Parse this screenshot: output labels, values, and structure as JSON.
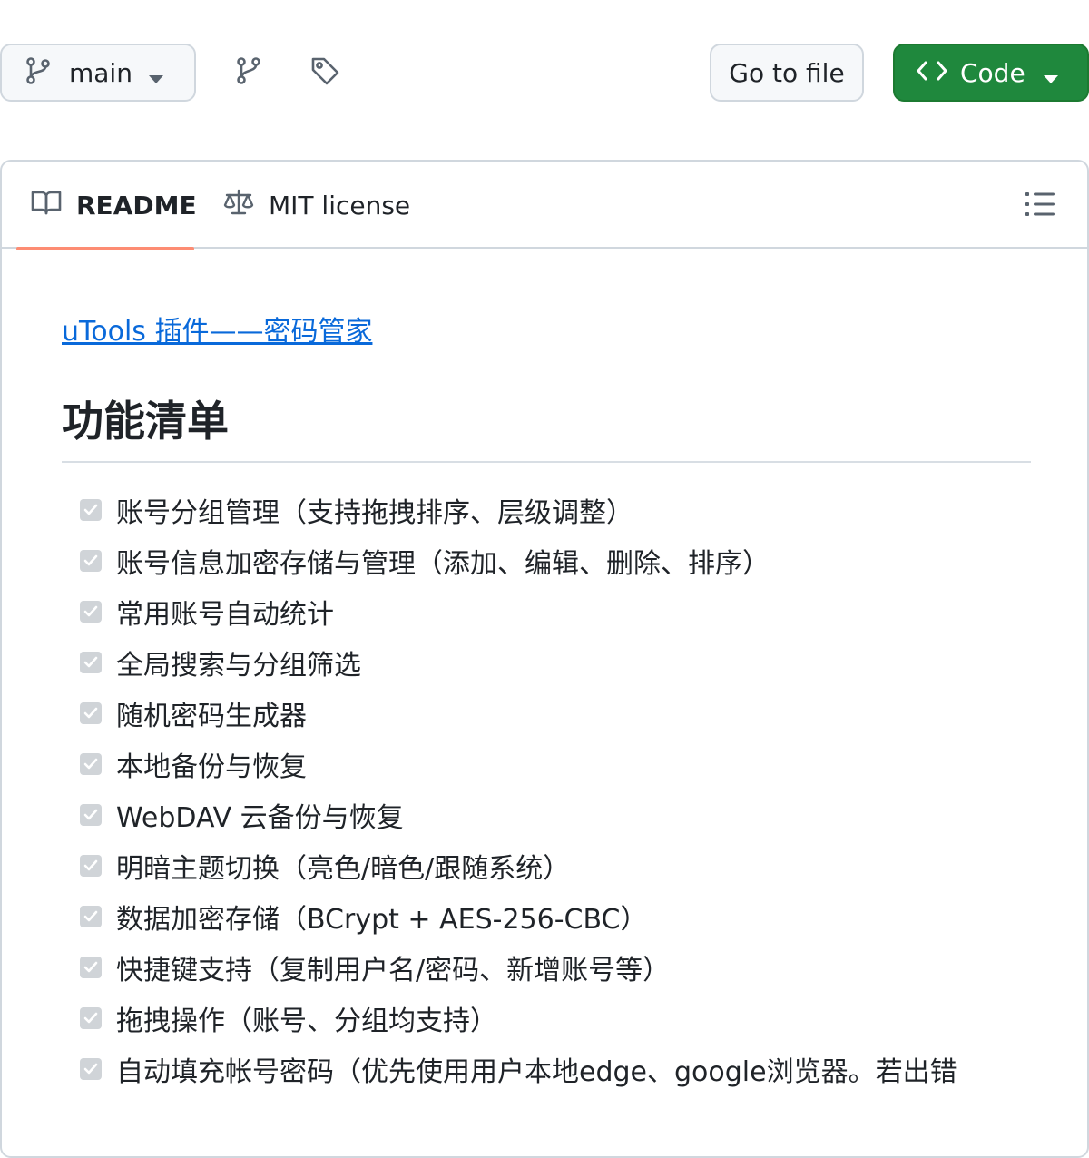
{
  "topbar": {
    "branch_label": "main",
    "goto_file_label": "Go to file",
    "code_label": "Code"
  },
  "readme": {
    "tabs": [
      {
        "label": "README"
      },
      {
        "label": "MIT license"
      }
    ],
    "link_text": "uTools 插件——密码管家",
    "section_title": "功能清单",
    "features": [
      "账号分组管理（支持拖拽排序、层级调整）",
      "账号信息加密存储与管理（添加、编辑、删除、排序）",
      "常用账号自动统计",
      "全局搜索与分组筛选",
      "随机密码生成器",
      "本地备份与恢复",
      "WebDAV 云备份与恢复",
      "明暗主题切换（亮色/暗色/跟随系统）",
      "数据加密存储（BCrypt + AES-256-CBC）",
      "快捷键支持（复制用户名/密码、新增账号等）",
      "拖拽操作（账号、分组均支持）",
      "自动填充帐号密码（优先使用用户本地edge、google浏览器。若出错"
    ]
  },
  "colors": {
    "accent_link": "#0969da",
    "code_button": "#1f883d",
    "tab_underline": "#fd8c73",
    "border": "#d0d7de"
  }
}
